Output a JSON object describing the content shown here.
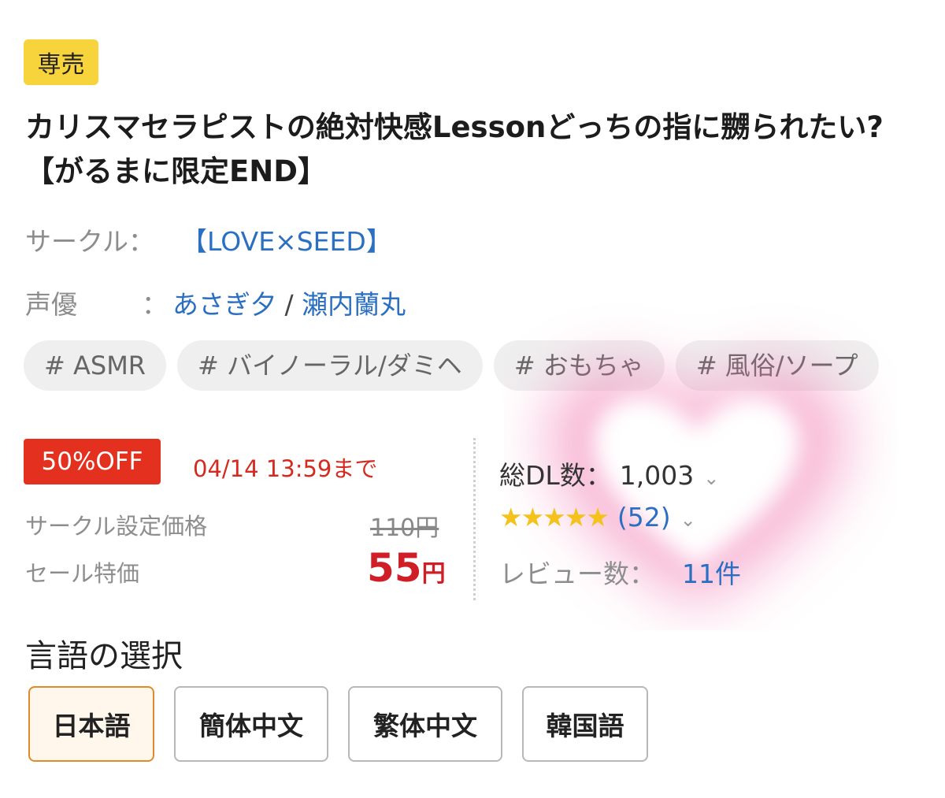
{
  "badge": "専売",
  "title": "カリスマセラピストの絶対快感Lessonどっちの指に嬲られたい?【がるまに限定END】",
  "circle": {
    "label": "サークル：",
    "name": "【LOVE×SEED】"
  },
  "voice": {
    "label": "声優",
    "colon": "：",
    "actors": [
      "あさぎ夕",
      "瀬内蘭丸"
    ],
    "separator": "/"
  },
  "tags": [
    "# ASMR",
    "# バイノーラル/ダミヘ",
    "# おもちゃ",
    "# 風俗/ソープ"
  ],
  "sale": {
    "discount": "50%OFF",
    "deadline": "04/14 13:59まで",
    "original_label": "サークル設定価格",
    "original_price": "110円",
    "sale_label": "セール特価",
    "sale_price": "55",
    "currency": "円"
  },
  "stats": {
    "downloads_label": "総DL数：",
    "downloads_value": "1,003",
    "stars": "★★★★★",
    "rating_count": "(52)",
    "reviews_label": "レビュー数：",
    "reviews_value": "11件"
  },
  "language": {
    "title": "言語の選択",
    "options": [
      "日本語",
      "簡体中文",
      "繁体中文",
      "韓国語"
    ],
    "selected": "日本語"
  },
  "colors": {
    "badge": "#f7d33c",
    "discount": "#e3301f",
    "sale_price": "#d01e27",
    "link": "#2b6fc2",
    "star": "#f4c21b",
    "selected_border": "#e08a2b",
    "heart_glow": "#f06aa8"
  },
  "icons": {
    "chevron": "chevron-down-icon",
    "heart": "heart-glow-icon"
  }
}
